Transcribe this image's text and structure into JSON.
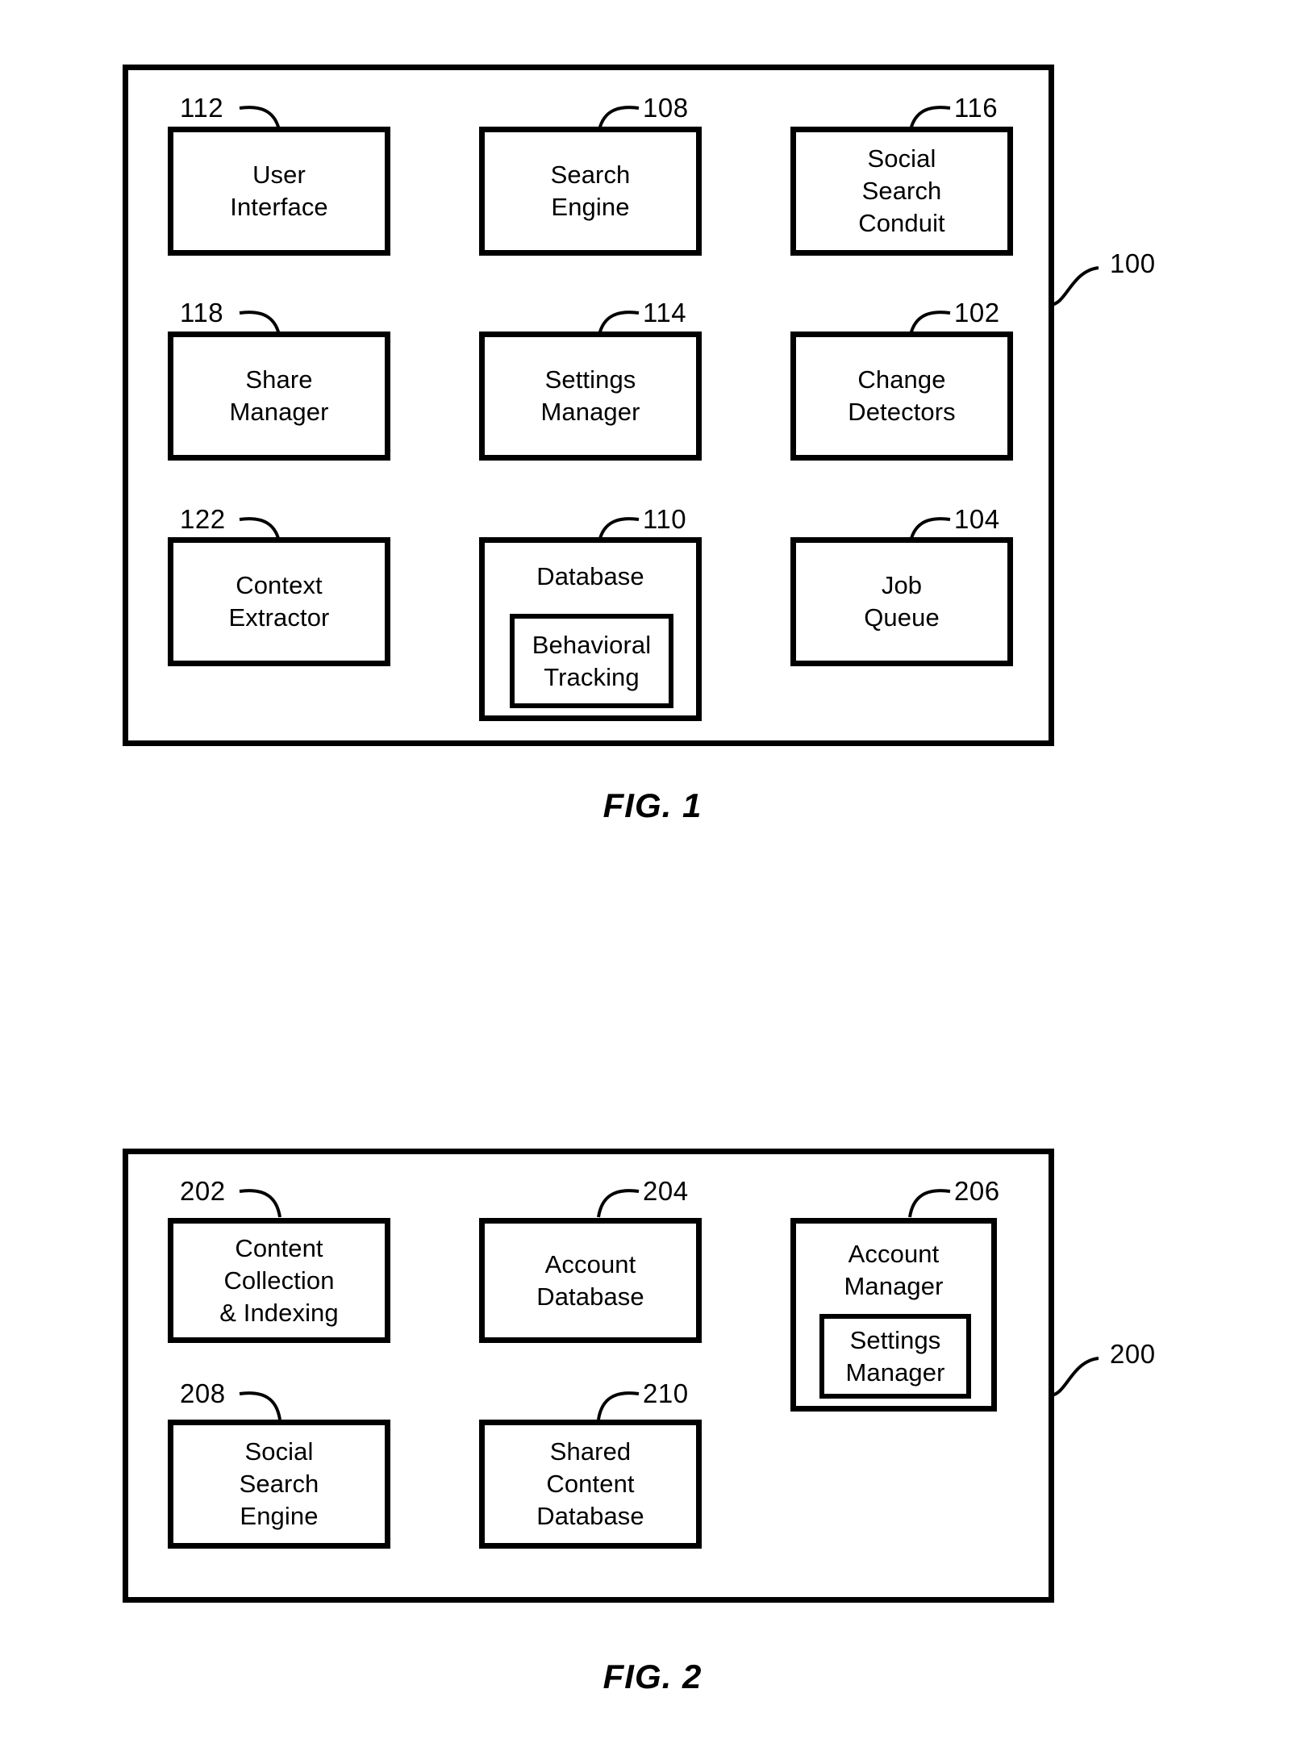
{
  "figures": [
    {
      "id": "fig1",
      "caption": "FIG. 1",
      "system_ref": "100",
      "components": [
        {
          "ref": "112",
          "label": "User\nInterface"
        },
        {
          "ref": "108",
          "label": "Search\nEngine"
        },
        {
          "ref": "116",
          "label": "Social\nSearch\nConduit"
        },
        {
          "ref": "118",
          "label": "Share\nManager"
        },
        {
          "ref": "114",
          "label": "Settings\nManager"
        },
        {
          "ref": "102",
          "label": "Change\nDetectors"
        },
        {
          "ref": "122",
          "label": "Context\nExtractor"
        },
        {
          "ref": "110",
          "label": "Database",
          "nested_label": "Behavioral\nTracking"
        },
        {
          "ref": "104",
          "label": "Job\nQueue"
        }
      ]
    },
    {
      "id": "fig2",
      "caption": "FIG. 2",
      "system_ref": "200",
      "components": [
        {
          "ref": "202",
          "label": "Content\nCollection\n& Indexing"
        },
        {
          "ref": "204",
          "label": "Account\nDatabase"
        },
        {
          "ref": "206",
          "label": "Account\nManager",
          "nested_label": "Settings\nManager"
        },
        {
          "ref": "208",
          "label": "Social\nSearch\nEngine"
        },
        {
          "ref": "210",
          "label": "Shared\nContent\nDatabase"
        }
      ]
    }
  ]
}
